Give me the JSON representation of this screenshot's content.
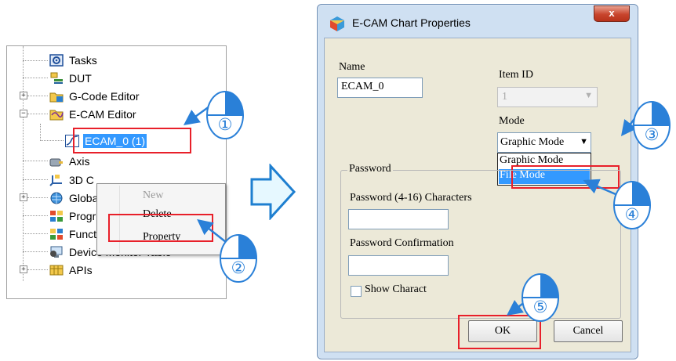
{
  "tree": {
    "items": [
      {
        "label": "Tasks",
        "icon": "gear-box-icon"
      },
      {
        "label": "DUT",
        "icon": "dut-icon"
      },
      {
        "label": "G-Code Editor",
        "icon": "folder-icon"
      },
      {
        "label": "E-CAM Editor",
        "icon": "folder-open-icon"
      },
      {
        "label": "ECAM_0 (1)",
        "icon": "cam-chart-icon"
      },
      {
        "label": "Axis",
        "icon": "axis-icon"
      },
      {
        "label": "3D C",
        "icon": "3d-icon"
      },
      {
        "label": "Globa",
        "icon": "globe-icon"
      },
      {
        "label": "Progr",
        "icon": "program-icon"
      },
      {
        "label": "Function Blocks",
        "icon": "function-block-icon"
      },
      {
        "label": "Device Monitor Table",
        "icon": "monitor-icon"
      },
      {
        "label": "APIs",
        "icon": "api-icon"
      }
    ]
  },
  "context_menu": {
    "items": [
      {
        "label": "New",
        "disabled": true
      },
      {
        "label": "Delete",
        "disabled": false
      },
      {
        "label": "Property",
        "disabled": false
      }
    ]
  },
  "dialog": {
    "title": "E-CAM Chart Properties",
    "close_glyph": "x",
    "name_label": "Name",
    "name_value": "ECAM_0",
    "item_id_label": "Item ID",
    "item_id_value": "1",
    "mode_label": "Mode",
    "mode_value": "Graphic Mode",
    "mode_options": [
      "Graphic Mode",
      "File Mode"
    ],
    "password_group_label": "Password",
    "password_label": "Password (4-16) Characters",
    "password_confirm_label": "Password Confirmation",
    "show_chars_label": "Show Charact",
    "ok_label": "OK",
    "cancel_label": "Cancel"
  },
  "callouts": [
    "①",
    "②",
    "③",
    "④",
    "⑤"
  ],
  "colors": {
    "highlight_red": "#e8202a",
    "callout_blue": "#2a80d8",
    "selection_blue": "#3399ff",
    "arrow_fill": "#e6f8ff"
  }
}
